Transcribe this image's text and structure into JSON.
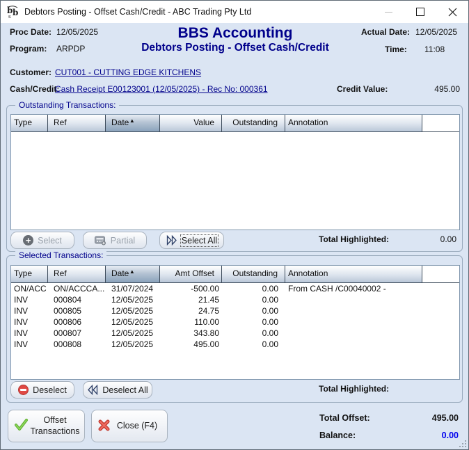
{
  "window": {
    "title": "Debtors Posting - Offset Cash/Credit - ABC Trading Pty Ltd"
  },
  "header": {
    "proc_date_label": "Proc Date:",
    "proc_date": "12/05/2025",
    "program_label": "Program:",
    "program": "ARPDP",
    "app_title": "BBS Accounting",
    "screen_title": "Debtors Posting - Offset Cash/Credit",
    "actual_date_label": "Actual Date:",
    "actual_date": "12/05/2025",
    "time_label": "Time:",
    "time": "11:08"
  },
  "details": {
    "customer_label": "Customer:",
    "customer_link": "CUT001 - CUTTING EDGE KITCHENS",
    "cash_credit_label": "Cash/Credit:",
    "cash_credit_link": "Cash Receipt E00123001 (12/05/2025) - Rec No: 000361",
    "credit_value_label": "Credit Value:",
    "credit_value": "495.00"
  },
  "outstanding": {
    "group_label": "Outstanding Transactions:",
    "columns": [
      "Type",
      "Ref",
      "Date",
      "Value",
      "Outstanding",
      "Annotation"
    ],
    "rows": [],
    "select_button": "Select",
    "partial_button": "Partial",
    "select_all_button": "Select All",
    "total_highlighted_label": "Total Highlighted:",
    "total_highlighted_value": "0.00"
  },
  "selected": {
    "group_label": "Selected Transactions:",
    "columns": [
      "Type",
      "Ref",
      "Date",
      "Amt Offset",
      "Outstanding",
      "Annotation"
    ],
    "rows": [
      {
        "type": "ON/ACC",
        "ref": "ON/ACCCA...",
        "date": "31/07/2024",
        "amt": "-500.00",
        "outstanding": "0.00",
        "annotation": "From CASH  /C00040002 -"
      },
      {
        "type": "INV",
        "ref": "000804",
        "date": "12/05/2025",
        "amt": "21.45",
        "outstanding": "0.00",
        "annotation": ""
      },
      {
        "type": "INV",
        "ref": "000805",
        "date": "12/05/2025",
        "amt": "24.75",
        "outstanding": "0.00",
        "annotation": ""
      },
      {
        "type": "INV",
        "ref": "000806",
        "date": "12/05/2025",
        "amt": "110.00",
        "outstanding": "0.00",
        "annotation": ""
      },
      {
        "type": "INV",
        "ref": "000807",
        "date": "12/05/2025",
        "amt": "343.80",
        "outstanding": "0.00",
        "annotation": ""
      },
      {
        "type": "INV",
        "ref": "000808",
        "date": "12/05/2025",
        "amt": "495.00",
        "outstanding": "0.00",
        "annotation": ""
      }
    ],
    "deselect_button": "Deselect",
    "deselect_all_button": "Deselect All",
    "total_highlighted_label": "Total Highlighted:",
    "total_highlighted_value": ""
  },
  "footer": {
    "offset_button": "Offset Transactions",
    "close_button": "Close (F4)",
    "total_offset_label": "Total Offset:",
    "total_offset_value": "495.00",
    "balance_label": "Balance:",
    "balance_value": "0.00"
  },
  "icons": {
    "sort_ascending": "▲"
  },
  "colors": {
    "navy": "#00008b",
    "balance_blue": "#0000ee",
    "background": "#dbe5f3"
  }
}
